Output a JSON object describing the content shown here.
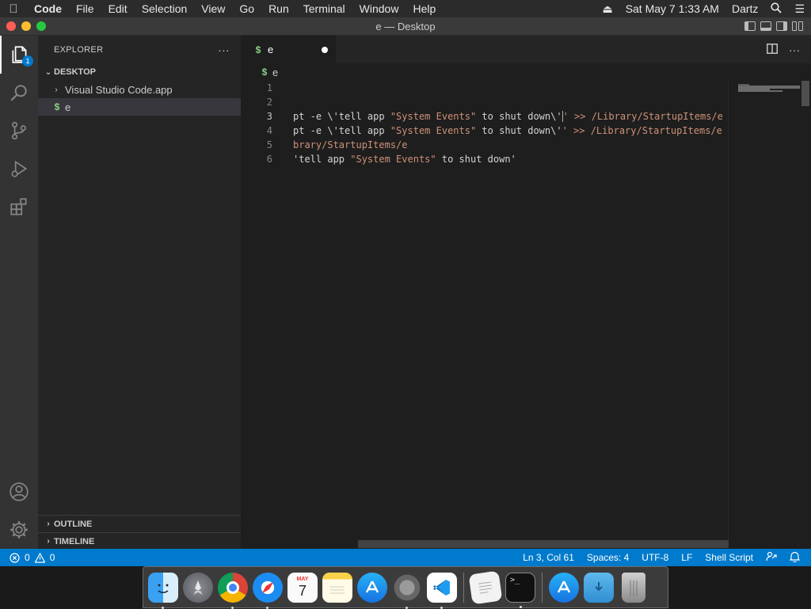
{
  "menubar": {
    "app_name": "Code",
    "menus": [
      "File",
      "Edit",
      "Selection",
      "View",
      "Go",
      "Run",
      "Terminal",
      "Window",
      "Help"
    ],
    "datetime": "Sat May 7  1:33 AM",
    "user": "Dartz"
  },
  "window": {
    "title": "e — Desktop"
  },
  "activity": {
    "explorer_badge": "1"
  },
  "sidebar": {
    "header": "EXPLORER",
    "more": "···",
    "folder": "DESKTOP",
    "items": [
      {
        "label": "Visual Studio Code.app",
        "kind": "folder"
      },
      {
        "label": "e",
        "kind": "shell",
        "icon_text": "$"
      }
    ],
    "outline": "OUTLINE",
    "timeline": "TIMELINE"
  },
  "editor": {
    "tab_label": "e",
    "tab_icon": "$",
    "breadcrumb_icon": "$",
    "breadcrumb": "e",
    "lines": [
      {
        "n": "1",
        "parts": []
      },
      {
        "n": "2",
        "parts": []
      },
      {
        "n": "3",
        "current": true,
        "parts": [
          {
            "t": "pt -e \\'tell app ",
            "c": "plain"
          },
          {
            "t": "\"System Events\"",
            "c": "str"
          },
          {
            "t": " to shut down\\'",
            "c": "plain"
          },
          {
            "t": "CURSOR",
            "c": "cursor"
          },
          {
            "t": "' >> /Library/StartupItems/e",
            "c": "str"
          }
        ]
      },
      {
        "n": "4",
        "parts": [
          {
            "t": "pt -e \\'tell app ",
            "c": "plain"
          },
          {
            "t": "\"System Events\"",
            "c": "str"
          },
          {
            "t": " to shut down\\'",
            "c": "plain"
          },
          {
            "t": "' >> /Library/StartupItems/e",
            "c": "str"
          }
        ]
      },
      {
        "n": "5",
        "parts": [
          {
            "t": "brary/StartupItems/e",
            "c": "str"
          }
        ]
      },
      {
        "n": "6",
        "parts": [
          {
            "t": "'tell app ",
            "c": "plain"
          },
          {
            "t": "\"System Events\"",
            "c": "str"
          },
          {
            "t": " to shut down'",
            "c": "plain"
          }
        ]
      }
    ]
  },
  "status": {
    "errors": "0",
    "warnings": "0",
    "position": "Ln 3, Col 61",
    "spaces": "Spaces: 4",
    "encoding": "UTF-8",
    "eol": "LF",
    "language": "Shell Script"
  },
  "dock": {
    "apps": [
      "Finder",
      "Launchpad",
      "Chrome",
      "Safari",
      "Calendar",
      "Notes",
      "App Store",
      "System Preferences",
      "Visual Studio Code",
      "TextEdit",
      "Terminal",
      "App Store Folder",
      "Downloads",
      "Trash"
    ],
    "calendar_month": "MAY",
    "calendar_day": "7"
  },
  "colors": {
    "accent": "#007acc",
    "string": "#ce9178",
    "shell_icon": "#89d185"
  }
}
